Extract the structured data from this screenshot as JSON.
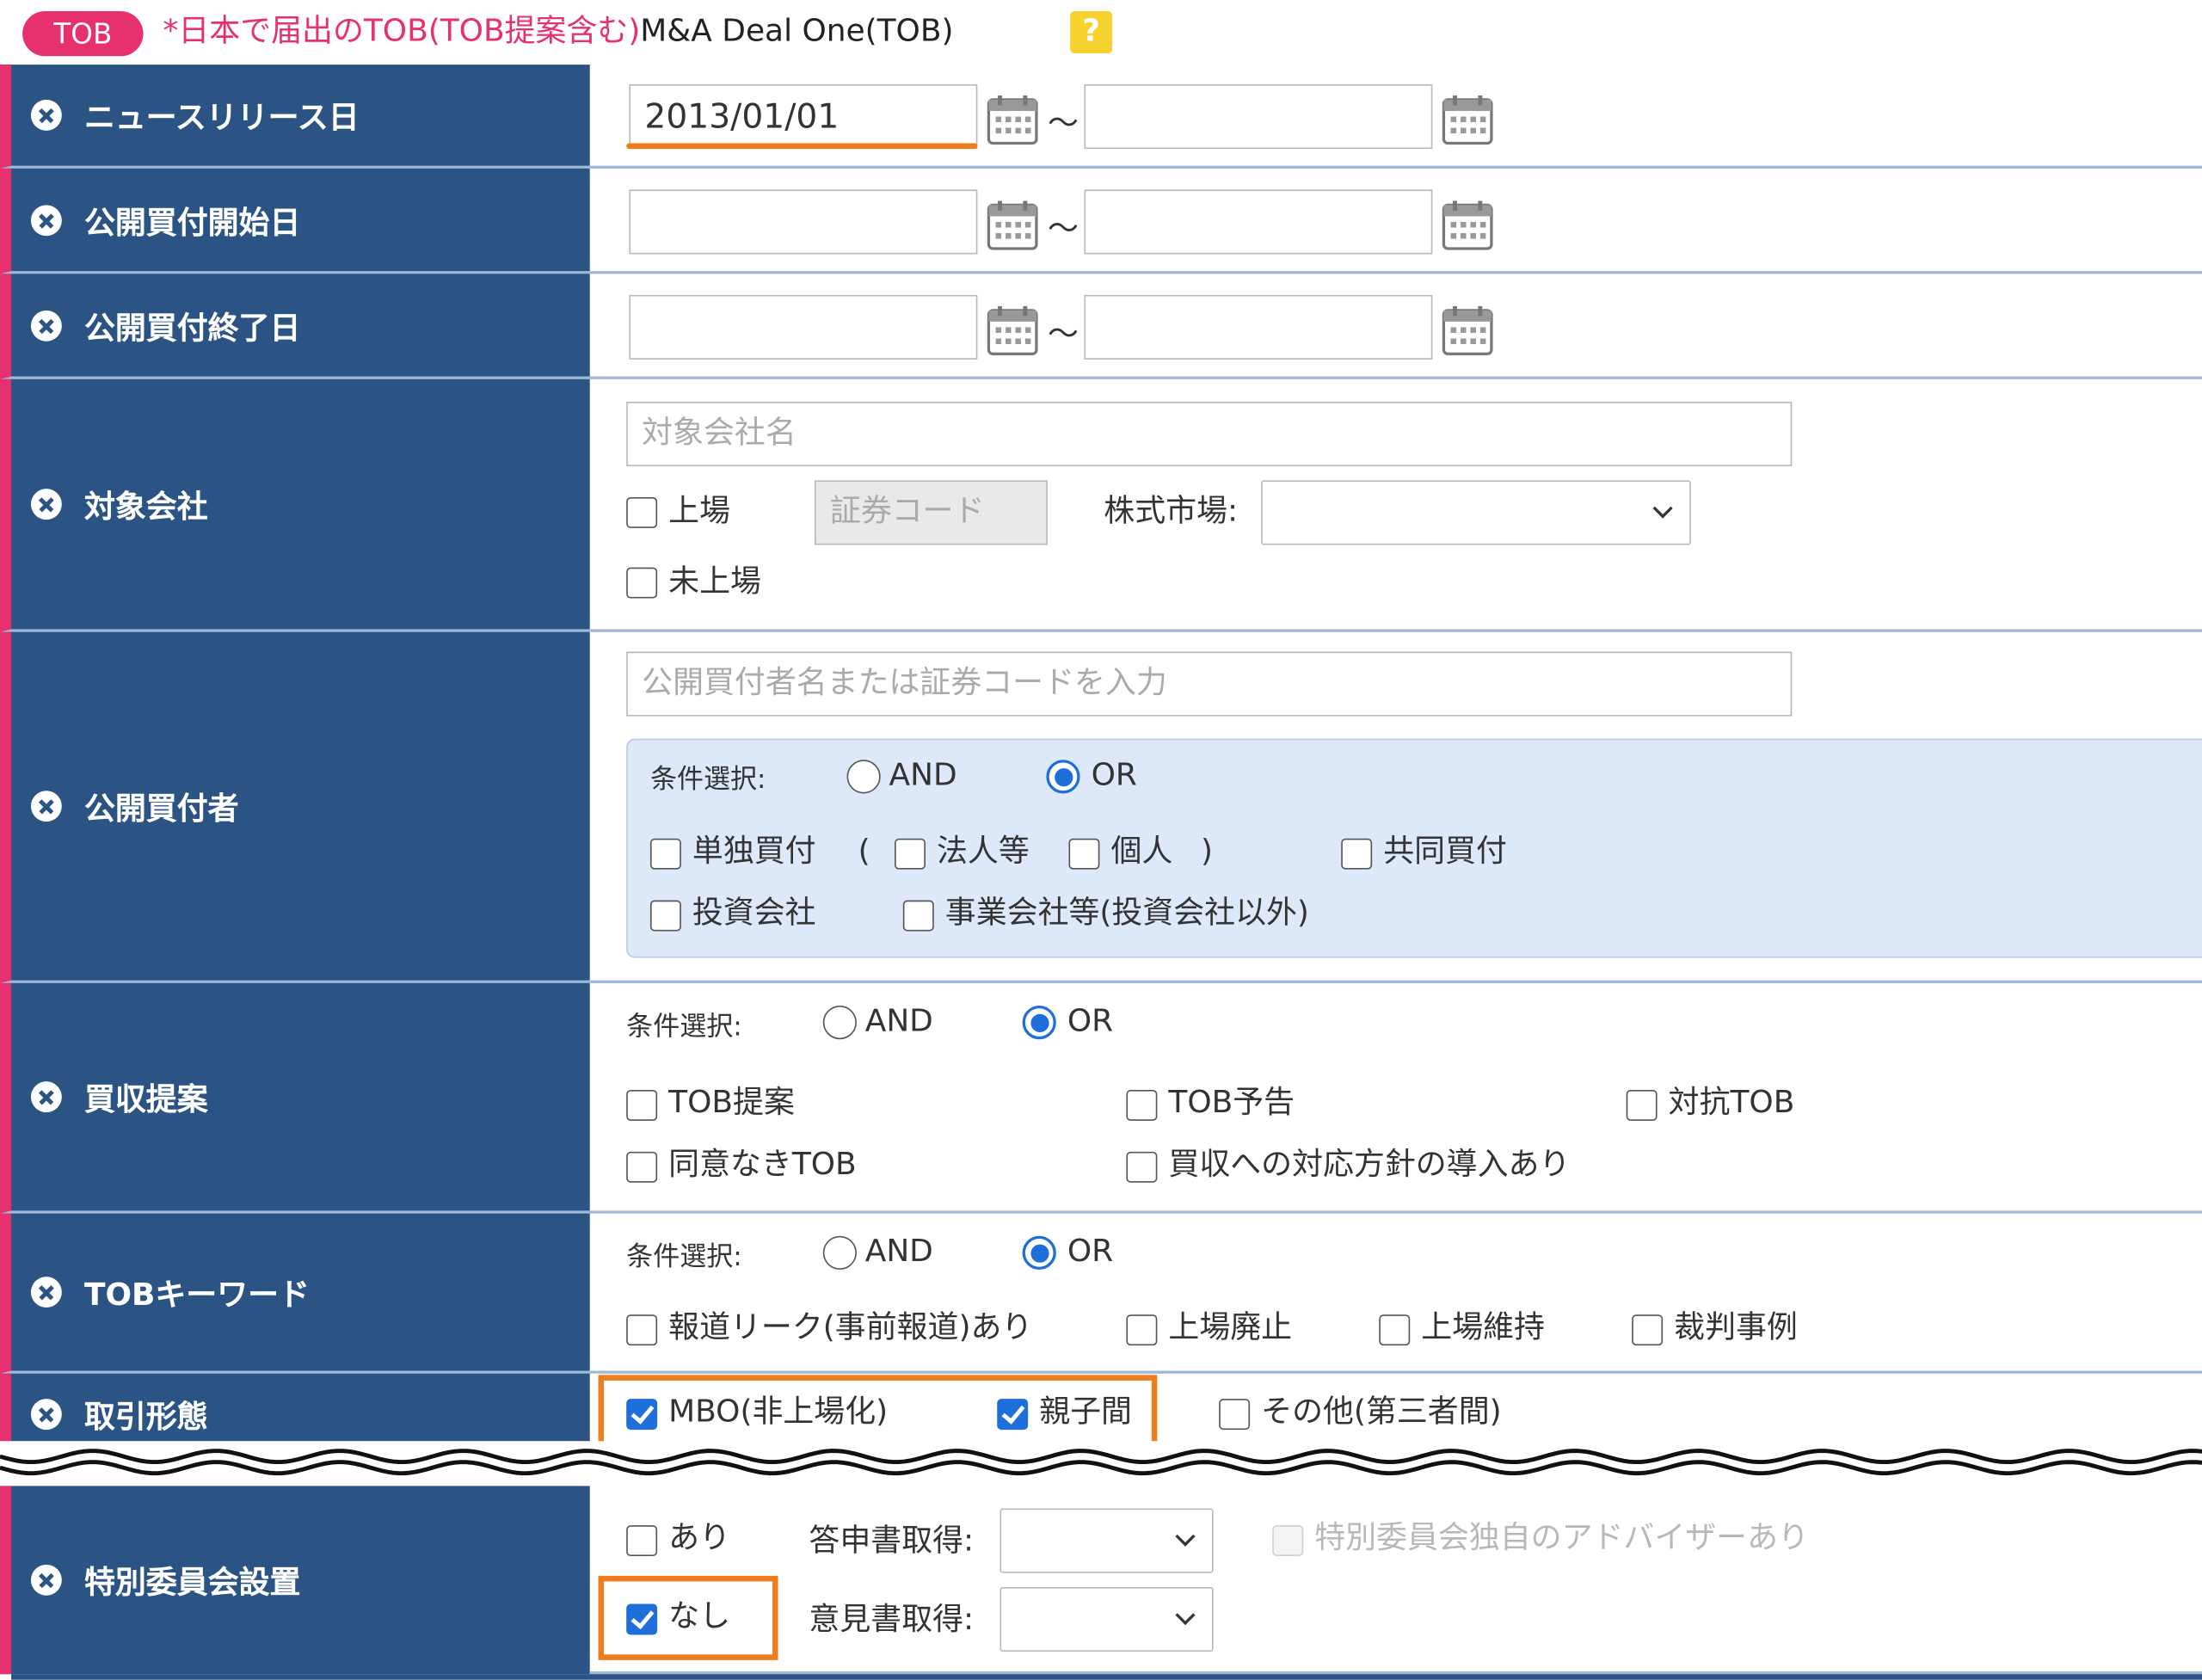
{
  "header": {
    "badge": "TOB",
    "note": "*日本で届出のTOB(TOB提案含む)",
    "db_name": "M&A Deal One(TOB)",
    "help": "?"
  },
  "date_range_separator": "～",
  "news_release": {
    "label": "ニュースリリース日",
    "from_value": "2013/01/01",
    "to_value": ""
  },
  "tob_start": {
    "label": "公開買付開始日",
    "from_value": "",
    "to_value": ""
  },
  "tob_end": {
    "label": "公開買付終了日",
    "from_value": "",
    "to_value": ""
  },
  "target": {
    "label": "対象会社",
    "name_placeholder": "対象会社名",
    "listed": "上場",
    "code_placeholder": "証券コード",
    "market_label": "株式市場:",
    "unlisted": "未上場"
  },
  "bidder": {
    "label": "公開買付者",
    "placeholder": "公開買付者名または証券コードを入力",
    "condition_label": "条件選択:",
    "and": "AND",
    "or": "OR",
    "single": "単独買付",
    "open_paren": "(",
    "corp": "法人等",
    "individual": "個人",
    "close_paren": ")",
    "joint": "共同買付",
    "investment": "投資会社",
    "business": "事業会社等(投資会社以外)"
  },
  "acquisition": {
    "label": "買収提案",
    "condition_label": "条件選択:",
    "and": "AND",
    "or": "OR",
    "tob_proposal": "TOB提案",
    "tob_notice": "TOB予告",
    "counter_tob": "対抗TOB",
    "hostile_tob": "同意なきTOB",
    "defense": "買収への対応方針の導入あり"
  },
  "keyword": {
    "label": "TOBキーワード",
    "condition_label": "条件選択:",
    "and": "AND",
    "or": "OR",
    "leak": "報道リーク(事前報道)あり",
    "delisting": "上場廃止",
    "maintain": "上場維持",
    "court": "裁判事例"
  },
  "deal_type": {
    "label": "取引形態",
    "mbo": "MBO(非上場化)",
    "parent": "親子間",
    "other": "その他(第三者間)"
  },
  "committee": {
    "label": "特別委員会設置",
    "yes": "あり",
    "no": "なし",
    "report_label": "答申書取得:",
    "opinion_label": "意見書取得:",
    "advisor": "特別委員会独自のアドバイザーあり"
  },
  "colors": {
    "label_bg": "#2b5484",
    "accent": "#e6306f",
    "highlight": "#f07d1c",
    "check": "#1e6fd9"
  }
}
